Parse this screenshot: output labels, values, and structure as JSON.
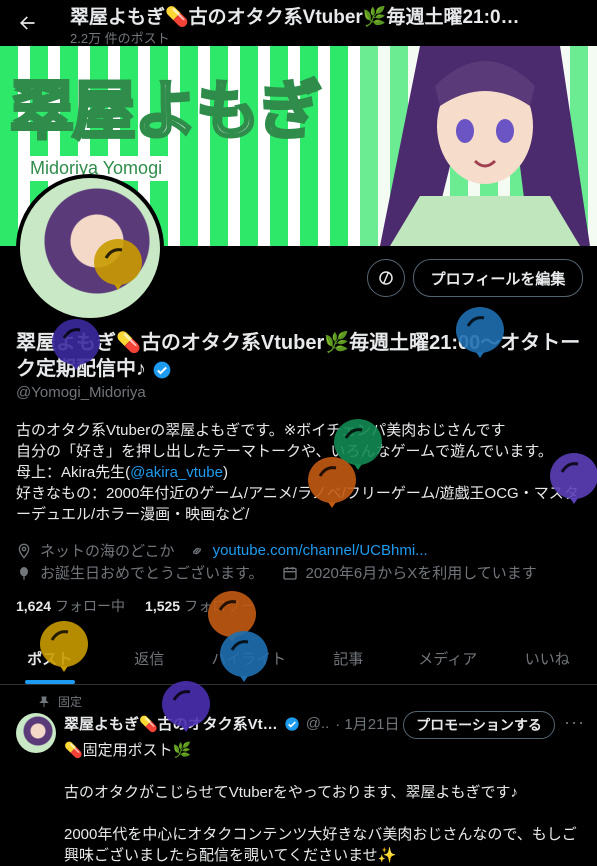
{
  "header": {
    "title": "翠屋よもぎ💊古のオタク系Vtuber🌿毎週土曜21:0…",
    "post_count": "2.2万 件のポスト"
  },
  "banner": {
    "logo_text": "翠屋よもぎ",
    "logo_sub": "Midoriya Yomogi"
  },
  "profile": {
    "edit_button": "プロフィールを編集",
    "name": "翠屋よもぎ💊古のオタク系Vtuber🌿毎週土曜21:00〜オタトーク定期配信中♪",
    "handle": "@Yomogi_Midoriya",
    "bio_line1": "古のオタク系Vtuberの翠屋よもぎです。※ボイチェンパ美肉おじさんです",
    "bio_line2": "自分の「好き」を押し出したテーマトークや、いろんなゲームで遊んでいます。",
    "bio_line3_prefix": "母上：Akira先生(",
    "bio_line3_link": "@akira_vtube",
    "bio_line3_suffix": ")",
    "bio_line4": "好きなもの：2000年付近のゲーム/アニメ/ラノベ/フリーゲーム/遊戯王OCG・マスターデュエル/ホラー漫画・映画など/",
    "location": "ネットの海のどこか",
    "website": "youtube.com/channel/UCBhmi...",
    "birthday": "お誕生日おめでとうございます。",
    "joined": "2020年6月からXを利用しています",
    "following_count": "1,624",
    "following_label": "フォロー中",
    "followers_count": "1,525",
    "followers_label": "フォロワー"
  },
  "tabs": [
    "ポスト",
    "返信",
    "ハイライト",
    "記事",
    "メディア",
    "いいね"
  ],
  "pinned_post": {
    "pinned_label": "固定",
    "author": "翠屋よもぎ💊古のオタク系Vt…",
    "handle_short": "@..",
    "date": "· 1月21日",
    "promo_button": "プロモーションする",
    "title": "💊固定用ポスト🌿",
    "para1": "古のオタクがこじらせてVtuberをやっております、翠屋よもぎです♪",
    "para2": "2000年代を中心にオタクコンテンツ大好きなバ美肉おじさんなので、もしご興味ございましたら配信を覗いてくださいませ✨"
  },
  "colors": {
    "accent": "#1d9bf0",
    "text": "#e7e9ea",
    "muted": "#71767b",
    "banner_green": "#2ee86a"
  },
  "balloons": [
    {
      "color": "#3b2a9e"
    },
    {
      "color": "#c99a00"
    },
    {
      "color": "#1f6fb0"
    },
    {
      "color": "#138a53"
    },
    {
      "color": "#c25a12"
    },
    {
      "color": "#5b3fb8"
    },
    {
      "color": "#c99a00"
    },
    {
      "color": "#c25a12"
    },
    {
      "color": "#1f6fb0"
    },
    {
      "color": "#4a2fb0"
    }
  ]
}
